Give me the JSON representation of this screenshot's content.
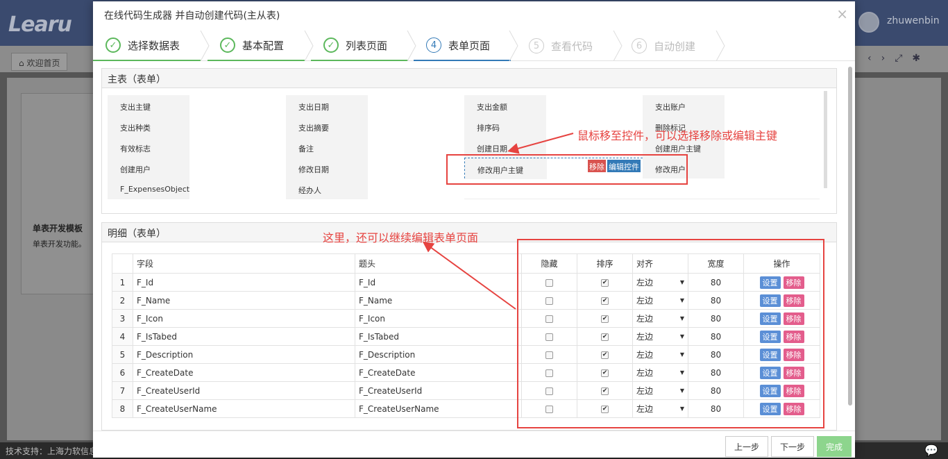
{
  "app": {
    "logo": "Learu",
    "user": "zhuwenbin",
    "home_tab": "欢迎首页",
    "card_title": "单表开发模板",
    "card_desc": "单表开发功能。",
    "footer": "技术支持：上海力软信息"
  },
  "modal": {
    "title": "在线代码生成器 并自动创建代码(主从表)",
    "close": "×",
    "steps": [
      {
        "num": "✓",
        "label": "选择数据表",
        "state": "done"
      },
      {
        "num": "✓",
        "label": "基本配置",
        "state": "done"
      },
      {
        "num": "✓",
        "label": "列表页面",
        "state": "done"
      },
      {
        "num": "4",
        "label": "表单页面",
        "state": "active"
      },
      {
        "num": "5",
        "label": "查看代码",
        "state": "todo"
      },
      {
        "num": "6",
        "label": "自动创建",
        "state": "todo"
      }
    ],
    "master": {
      "title": "主表（表单）",
      "rows": [
        [
          "支出主键",
          "支出日期",
          "支出金额",
          "支出账户"
        ],
        [
          "支出种类",
          "支出摘要",
          "排序码",
          "删除标记"
        ],
        [
          "有效标志",
          "备注",
          "创建日期",
          "创建用户主键"
        ],
        [
          "创建用户",
          "修改日期",
          "修改用户主键",
          "修改用户"
        ],
        [
          "F_ExpensesObject",
          "经办人",
          "",
          ""
        ]
      ],
      "remove_label": "移除",
      "edit_label": "编辑控件"
    },
    "detail": {
      "title": "明细（表单）",
      "headers": [
        "",
        "字段",
        "题头",
        "隐藏",
        "排序",
        "对齐",
        "宽度",
        "操作"
      ],
      "rows": [
        {
          "n": "1",
          "field": "F_Id",
          "title": "F_Id",
          "align": "左边",
          "width": "80"
        },
        {
          "n": "2",
          "field": "F_Name",
          "title": "F_Name",
          "align": "左边",
          "width": "80"
        },
        {
          "n": "3",
          "field": "F_Icon",
          "title": "F_Icon",
          "align": "左边",
          "width": "80"
        },
        {
          "n": "4",
          "field": "F_IsTabed",
          "title": "F_IsTabed",
          "align": "左边",
          "width": "80"
        },
        {
          "n": "5",
          "field": "F_Description",
          "title": "F_Description",
          "align": "左边",
          "width": "80"
        },
        {
          "n": "6",
          "field": "F_CreateDate",
          "title": "F_CreateDate",
          "align": "左边",
          "width": "80"
        },
        {
          "n": "7",
          "field": "F_CreateUserId",
          "title": "F_CreateUserId",
          "align": "左边",
          "width": "80"
        },
        {
          "n": "8",
          "field": "F_CreateUserName",
          "title": "F_CreateUserName",
          "align": "左边",
          "width": "80"
        }
      ],
      "set_label": "设置",
      "rm_label": "移除"
    },
    "footer": {
      "prev": "上一步",
      "next": "下一步",
      "done": "完成"
    }
  },
  "annotations": {
    "top": "鼠标移至控件，可以选择移除或编辑主键",
    "middle": "这里，还可以继续编辑表单页面",
    "color": "#e64340"
  }
}
